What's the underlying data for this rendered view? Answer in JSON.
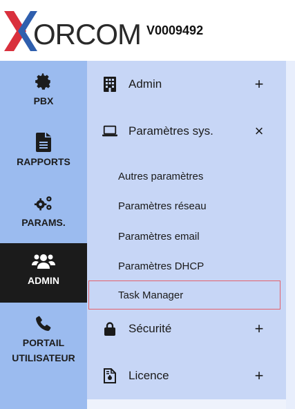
{
  "header": {
    "logo_text": "ORCOM",
    "device_id": "V0009492"
  },
  "sidebar": {
    "items": [
      {
        "label": "PBX",
        "icon": "gear-icon"
      },
      {
        "label": "RAPPORTS",
        "icon": "document-icon"
      },
      {
        "label": "PARAMS.",
        "icon": "gears-icon"
      },
      {
        "label": "ADMIN",
        "icon": "users-icon",
        "active": true
      },
      {
        "label": "PORTAIL UTILISATEUR",
        "icon": "phone-icon"
      }
    ]
  },
  "submenu": {
    "sections": [
      {
        "label": "Admin",
        "icon": "building-icon",
        "toggle": "+"
      },
      {
        "label": "Paramètres sys.",
        "icon": "laptop-icon",
        "toggle": "×"
      },
      {
        "label": "Sécurité",
        "icon": "lock-icon",
        "toggle": "+"
      },
      {
        "label": "Licence",
        "icon": "file-contract-icon",
        "toggle": "+"
      }
    ],
    "sys_items": [
      {
        "label": "Autres paramètres"
      },
      {
        "label": "Paramètres réseau"
      },
      {
        "label": "Paramètres email"
      },
      {
        "label": "Paramètres DHCP"
      },
      {
        "label": "Task Manager",
        "selected": true
      }
    ]
  },
  "colors": {
    "sidebar_bg": "#9bbbef",
    "submenu_bg": "#c7d6f6",
    "active_bg": "#1b1b1b",
    "selected_border": "#e4606a",
    "logo_x_red": "#d9303d",
    "logo_x_blue": "#2f5fae"
  }
}
